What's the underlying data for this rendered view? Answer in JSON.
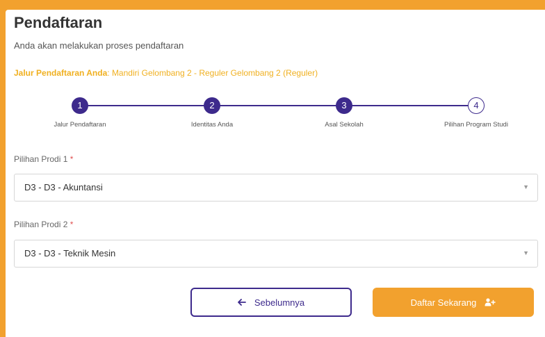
{
  "header": {
    "title": "Pendaftaran",
    "subtitle": "Anda akan melakukan proses pendaftaran",
    "jalur_label": "Jalur Pendaftaran Anda",
    "jalur_value": "Mandiri Gelombang 2 - Reguler Gelombang 2 (Reguler)"
  },
  "steps": [
    {
      "number": "1",
      "label": "Jalur Pendaftaran",
      "status": "completed"
    },
    {
      "number": "2",
      "label": "Identitas Anda",
      "status": "completed"
    },
    {
      "number": "3",
      "label": "Asal Sekolah",
      "status": "completed"
    },
    {
      "number": "4",
      "label": "Pilihan Program Studi",
      "status": "current"
    }
  ],
  "form": {
    "prodi1_label": "Pilihan Prodi 1",
    "prodi1_value": "D3 - D3 - Akuntansi",
    "prodi2_label": "Pilihan Prodi 2",
    "prodi2_value": "D3 - D3 - Teknik Mesin",
    "required_mark": "*"
  },
  "buttons": {
    "prev_label": "Sebelumnya",
    "next_label": "Daftar Sekarang"
  },
  "colors": {
    "accent_orange": "#f2a12e",
    "accent_purple": "#3d2a8c",
    "required_red": "#e05050"
  },
  "icons": {
    "prev": "arrow-left-icon",
    "next": "user-add-icon",
    "select": "caret-down-icon"
  }
}
